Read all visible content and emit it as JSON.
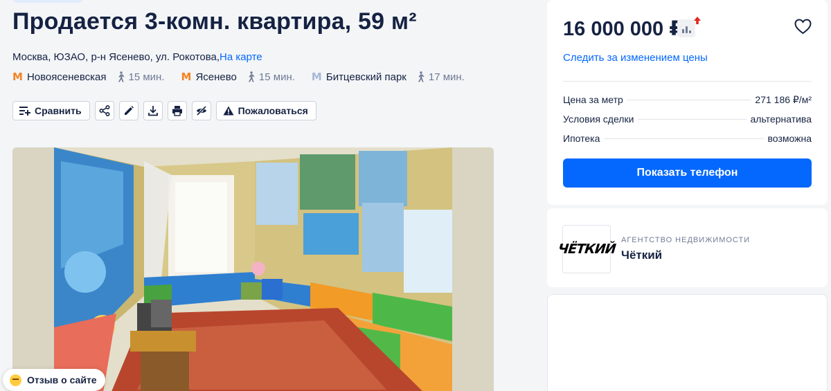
{
  "listing": {
    "title": "Продается 3-комн. квартира, 59 м²",
    "address": "Москва, ЮЗАО, р-н Ясенево, ул. Рокотова,",
    "map_link": "На карте",
    "metro": [
      {
        "name": "Новоясеневская",
        "walk": "15 мин.",
        "color": "#f58220"
      },
      {
        "name": "Ясенево",
        "walk": "15 мин.",
        "color": "#f58220"
      },
      {
        "name": "Битцевский парк",
        "walk": "17 мин.",
        "color": "#a8b7d8"
      }
    ]
  },
  "actions": {
    "compare": "Сравнить",
    "complain": "Пожаловаться",
    "icons": [
      "share-icon",
      "edit-icon",
      "download-icon",
      "print-icon",
      "hide-icon"
    ]
  },
  "price_card": {
    "price": "16 000 000 ₽",
    "watch_link": "Следить за изменением цены",
    "params": [
      {
        "label": "Цена за метр",
        "value": "271 186 ₽/м²"
      },
      {
        "label": "Условия сделки",
        "value": "альтернатива"
      },
      {
        "label": "Ипотека",
        "value": "возможна"
      }
    ],
    "show_phone": "Показать телефон"
  },
  "agent": {
    "logo_text": "ЧЁТКИЙ",
    "type": "Агентство недвижимости",
    "name": "Чёткий"
  },
  "feedback": {
    "label": "Отзыв о сайте"
  },
  "colors": {
    "accent": "#0468ff",
    "text": "#152242",
    "secondary": "#707a95",
    "price_up": "#e0261f",
    "metro_orange": "#f58220"
  }
}
